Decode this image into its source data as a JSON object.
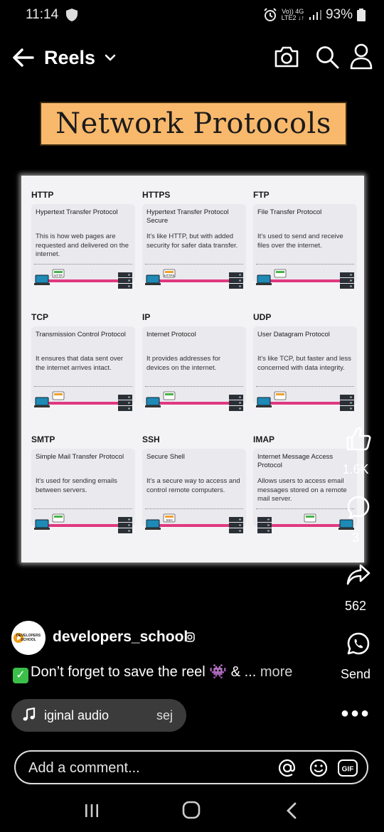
{
  "status_bar": {
    "time": "11:14",
    "network_top": "Vo)) 4G",
    "network_bottom": "LTE2 ↓↑",
    "battery": "93%"
  },
  "header": {
    "title": "Reels"
  },
  "video": {
    "banner_title": "Network Protocols",
    "protocols": [
      {
        "name": "HTTP",
        "full": "Hypertext Transfer Protocol",
        "desc": "This is how web pages are requested and delivered on the internet."
      },
      {
        "name": "HTTPS",
        "full": "Hypertext Transfer Protocol Secure",
        "desc": "It's like HTTP, but with added security for safer data transfer."
      },
      {
        "name": "FTP",
        "full": "File Transfer Protocol",
        "desc": "It's used to send and receive files over the internet."
      },
      {
        "name": "TCP",
        "full": "Transmission Control Protocol",
        "desc": "It ensures that data sent over the internet arrives intact."
      },
      {
        "name": "IP",
        "full": "Internet Protocol",
        "desc": "It provides addresses for devices on the internet."
      },
      {
        "name": "UDP",
        "full": "User Datagram Protocol",
        "desc": "It's like TCP, but faster and less concerned with data integrity."
      },
      {
        "name": "SMTP",
        "full": "Simple Mail Transfer Protocol",
        "desc": "It's used for sending emails between servers."
      },
      {
        "name": "SSH",
        "full": "Secure Shell",
        "desc": "It's a secure way to access and control remote computers."
      },
      {
        "name": "IMAP",
        "full": "Internet Message Access Protocol",
        "desc": "Allows users to access email messages stored on a remote mail server."
      }
    ],
    "diagram_badges": [
      "HTTP",
      "HTTPS",
      "",
      "",
      "",
      "",
      "",
      "SSH",
      ""
    ]
  },
  "actions": {
    "likes": "1.6K",
    "comments": "3",
    "shares": "562",
    "send_label": "Send"
  },
  "post": {
    "avatar_text": "DEVELOPERS SCHOOL",
    "author": "developers_school",
    "caption_text": "Don’t forget to save the reel 👾 & ... ",
    "more_label": "more",
    "audio_label": "iginal audio",
    "audio_user": "sej"
  },
  "comment": {
    "placeholder": "Add a comment..."
  },
  "colors": {
    "banner": "#f9b96c",
    "link_line": "#e0387f",
    "laptop": "#1e8ab5",
    "server": "#2b2f36"
  }
}
